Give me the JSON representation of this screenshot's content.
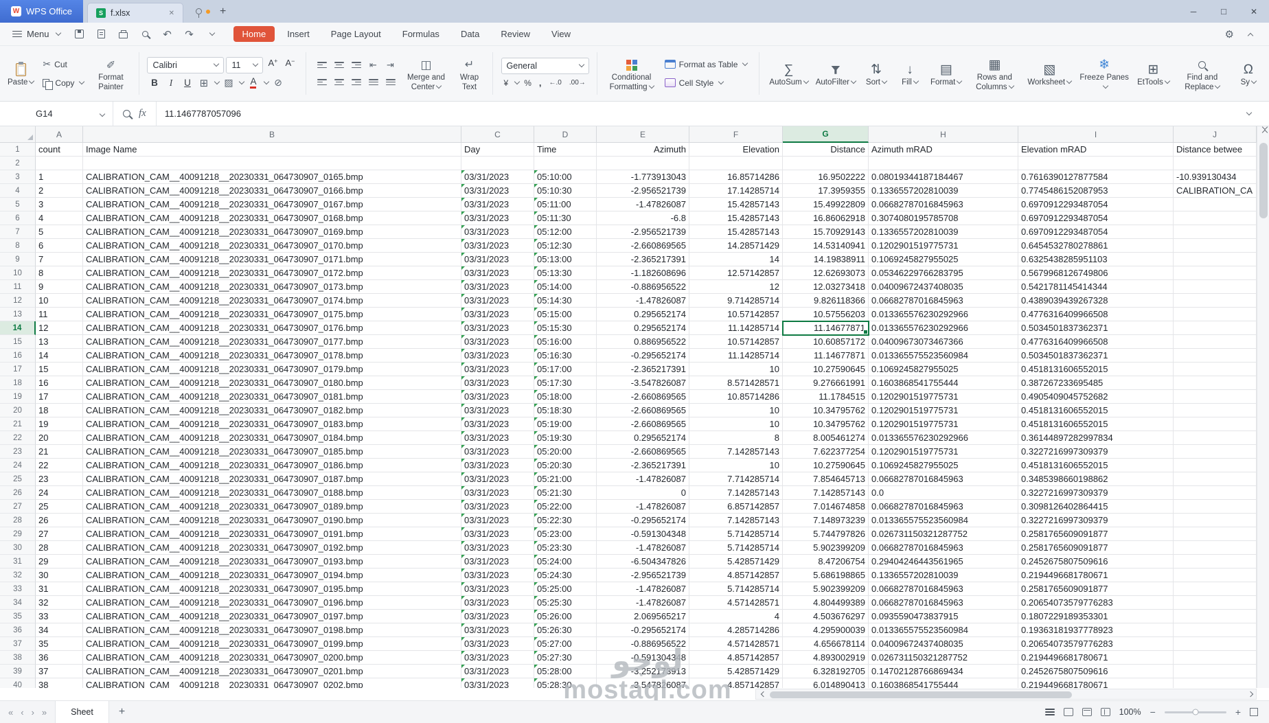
{
  "titlebar": {
    "app_tab": "WPS Office",
    "doc_tab": "f.xlsx"
  },
  "menubar": {
    "menu_label": "Menu",
    "tabs": [
      "Home",
      "Insert",
      "Page Layout",
      "Formulas",
      "Data",
      "Review",
      "View"
    ],
    "active_tab": "Home"
  },
  "ribbon": {
    "clipboard": {
      "paste": "Paste",
      "cut": "Cut",
      "copy": "Copy",
      "format_painter": "Format Painter"
    },
    "font": {
      "family": "Calibri",
      "size": "11"
    },
    "alignment": {
      "merge": "Merge and Center",
      "wrap": "Wrap Text"
    },
    "number": {
      "format": "General"
    },
    "styles": {
      "conditional": "Conditional Formatting",
      "table": "Format as Table",
      "cell": "Cell Style"
    },
    "tools": [
      "AutoSum",
      "AutoFilter",
      "Sort",
      "Fill",
      "Format",
      "Rows and Columns",
      "Worksheet",
      "Freeze Panes",
      "EtTools",
      "Find and Replace",
      "Sy"
    ]
  },
  "formula_bar": {
    "name_box": "G14",
    "fx_label": "fx",
    "value": "11.1467787057096"
  },
  "statusbar": {
    "sheet_tab": "Sheet",
    "zoom": "100%"
  },
  "watermark": {
    "line1": "لوجو",
    "line2": "mostaql.com"
  },
  "sheet": {
    "columns": [
      "A",
      "B",
      "C",
      "D",
      "E",
      "F",
      "G",
      "H",
      "I",
      "J"
    ],
    "selection": {
      "col": "G",
      "row": 14
    },
    "rows": [
      {
        "n": 1,
        "v": [
          "count",
          "Image Name",
          "Day",
          "Time",
          "Azimuth",
          "Elevation",
          "Distance",
          "Azimuth mRAD",
          "Elevation mRAD",
          "Distance betwee"
        ]
      },
      {
        "n": 2,
        "v": [
          "",
          "",
          "",
          "",
          "",
          "",
          "",
          "",
          "",
          ""
        ]
      },
      {
        "n": 3,
        "v": [
          "1",
          "CALIBRATION_CAM__40091218__20230331_064730907_0165.bmp",
          "03/31/2023",
          "05:10:00",
          "-1.773913043",
          "16.85714286",
          "16.9502222",
          "0.08019344187184467",
          "0.7616390127877584",
          "-10.939130434"
        ]
      },
      {
        "n": 4,
        "v": [
          "2",
          "CALIBRATION_CAM__40091218__20230331_064730907_0166.bmp",
          "03/31/2023",
          "05:10:30",
          "-2.956521739",
          "17.14285714",
          "17.3959355",
          "0.1336557202810039",
          "0.7745486152087953",
          "CALIBRATION_CA"
        ]
      },
      {
        "n": 5,
        "v": [
          "3",
          "CALIBRATION_CAM__40091218__20230331_064730907_0167.bmp",
          "03/31/2023",
          "05:11:00",
          "-1.47826087",
          "15.42857143",
          "15.49922809",
          "0.06682787016845963",
          "0.6970912293487054",
          ""
        ]
      },
      {
        "n": 6,
        "v": [
          "4",
          "CALIBRATION_CAM__40091218__20230331_064730907_0168.bmp",
          "03/31/2023",
          "05:11:30",
          "-6.8",
          "15.42857143",
          "16.86062918",
          "0.3074080195785708",
          "0.6970912293487054",
          ""
        ]
      },
      {
        "n": 7,
        "v": [
          "5",
          "CALIBRATION_CAM__40091218__20230331_064730907_0169.bmp",
          "03/31/2023",
          "05:12:00",
          "-2.956521739",
          "15.42857143",
          "15.70929143",
          "0.1336557202810039",
          "0.6970912293487054",
          ""
        ]
      },
      {
        "n": 8,
        "v": [
          "6",
          "CALIBRATION_CAM__40091218__20230331_064730907_0170.bmp",
          "03/31/2023",
          "05:12:30",
          "-2.660869565",
          "14.28571429",
          "14.53140941",
          "0.1202901519775731",
          "0.6454532780278861",
          ""
        ]
      },
      {
        "n": 9,
        "v": [
          "7",
          "CALIBRATION_CAM__40091218__20230331_064730907_0171.bmp",
          "03/31/2023",
          "05:13:00",
          "-2.365217391",
          "14",
          "14.19838911",
          "0.1069245827955025",
          "0.6325438285951103",
          ""
        ]
      },
      {
        "n": 10,
        "v": [
          "8",
          "CALIBRATION_CAM__40091218__20230331_064730907_0172.bmp",
          "03/31/2023",
          "05:13:30",
          "-1.182608696",
          "12.57142857",
          "12.62693073",
          "0.05346229766283795",
          "0.5679968126749806",
          ""
        ]
      },
      {
        "n": 11,
        "v": [
          "9",
          "CALIBRATION_CAM__40091218__20230331_064730907_0173.bmp",
          "03/31/2023",
          "05:14:00",
          "-0.886956522",
          "12",
          "12.03273418",
          "0.04009672437408035",
          "0.5421781145414344",
          ""
        ]
      },
      {
        "n": 12,
        "v": [
          "10",
          "CALIBRATION_CAM__40091218__20230331_064730907_0174.bmp",
          "03/31/2023",
          "05:14:30",
          "-1.47826087",
          "9.714285714",
          "9.826118366",
          "0.06682787016845963",
          "0.4389039439267328",
          ""
        ]
      },
      {
        "n": 13,
        "v": [
          "11",
          "CALIBRATION_CAM__40091218__20230331_064730907_0175.bmp",
          "03/31/2023",
          "05:15:00",
          "0.295652174",
          "10.57142857",
          "10.57556203",
          "0.013365576230292966",
          "0.4776316409966508",
          ""
        ]
      },
      {
        "n": 14,
        "v": [
          "12",
          "CALIBRATION_CAM__40091218__20230331_064730907_0176.bmp",
          "03/31/2023",
          "05:15:30",
          "0.295652174",
          "11.14285714",
          "11.14677871",
          "0.013365576230292966",
          "0.5034501837362371",
          ""
        ]
      },
      {
        "n": 15,
        "v": [
          "13",
          "CALIBRATION_CAM__40091218__20230331_064730907_0177.bmp",
          "03/31/2023",
          "05:16:00",
          "0.886956522",
          "10.57142857",
          "10.60857172",
          "0.04009673073467366",
          "0.4776316409966508",
          ""
        ]
      },
      {
        "n": 16,
        "v": [
          "14",
          "CALIBRATION_CAM__40091218__20230331_064730907_0178.bmp",
          "03/31/2023",
          "05:16:30",
          "-0.295652174",
          "11.14285714",
          "11.14677871",
          "0.013365575523560984",
          "0.5034501837362371",
          ""
        ]
      },
      {
        "n": 17,
        "v": [
          "15",
          "CALIBRATION_CAM__40091218__20230331_064730907_0179.bmp",
          "03/31/2023",
          "05:17:00",
          "-2.365217391",
          "10",
          "10.27590645",
          "0.1069245827955025",
          "0.4518131606552015",
          ""
        ]
      },
      {
        "n": 18,
        "v": [
          "16",
          "CALIBRATION_CAM__40091218__20230331_064730907_0180.bmp",
          "03/31/2023",
          "05:17:30",
          "-3.547826087",
          "8.571428571",
          "9.276661991",
          "0.1603868541755444",
          "0.387267233695485",
          ""
        ]
      },
      {
        "n": 19,
        "v": [
          "17",
          "CALIBRATION_CAM__40091218__20230331_064730907_0181.bmp",
          "03/31/2023",
          "05:18:00",
          "-2.660869565",
          "10.85714286",
          "11.1784515",
          "0.1202901519775731",
          "0.4905409045752682",
          ""
        ]
      },
      {
        "n": 20,
        "v": [
          "18",
          "CALIBRATION_CAM__40091218__20230331_064730907_0182.bmp",
          "03/31/2023",
          "05:18:30",
          "-2.660869565",
          "10",
          "10.34795762",
          "0.1202901519775731",
          "0.4518131606552015",
          ""
        ]
      },
      {
        "n": 21,
        "v": [
          "19",
          "CALIBRATION_CAM__40091218__20230331_064730907_0183.bmp",
          "03/31/2023",
          "05:19:00",
          "-2.660869565",
          "10",
          "10.34795762",
          "0.1202901519775731",
          "0.4518131606552015",
          ""
        ]
      },
      {
        "n": 22,
        "v": [
          "20",
          "CALIBRATION_CAM__40091218__20230331_064730907_0184.bmp",
          "03/31/2023",
          "05:19:30",
          "0.295652174",
          "8",
          "8.005461274",
          "0.013365576230292966",
          "0.36144897282997834",
          ""
        ]
      },
      {
        "n": 23,
        "v": [
          "21",
          "CALIBRATION_CAM__40091218__20230331_064730907_0185.bmp",
          "03/31/2023",
          "05:20:00",
          "-2.660869565",
          "7.142857143",
          "7.622377254",
          "0.1202901519775731",
          "0.3227216997309379",
          ""
        ]
      },
      {
        "n": 24,
        "v": [
          "22",
          "CALIBRATION_CAM__40091218__20230331_064730907_0186.bmp",
          "03/31/2023",
          "05:20:30",
          "-2.365217391",
          "10",
          "10.27590645",
          "0.1069245827955025",
          "0.4518131606552015",
          ""
        ]
      },
      {
        "n": 25,
        "v": [
          "23",
          "CALIBRATION_CAM__40091218__20230331_064730907_0187.bmp",
          "03/31/2023",
          "05:21:00",
          "-1.47826087",
          "7.714285714",
          "7.854645713",
          "0.06682787016845963",
          "0.3485398660198862",
          ""
        ]
      },
      {
        "n": 26,
        "v": [
          "24",
          "CALIBRATION_CAM__40091218__20230331_064730907_0188.bmp",
          "03/31/2023",
          "05:21:30",
          "0",
          "7.142857143",
          "7.142857143",
          "0.0",
          "0.3227216997309379",
          ""
        ]
      },
      {
        "n": 27,
        "v": [
          "25",
          "CALIBRATION_CAM__40091218__20230331_064730907_0189.bmp",
          "03/31/2023",
          "05:22:00",
          "-1.47826087",
          "6.857142857",
          "7.014674858",
          "0.06682787016845963",
          "0.3098126402864415",
          ""
        ]
      },
      {
        "n": 28,
        "v": [
          "26",
          "CALIBRATION_CAM__40091218__20230331_064730907_0190.bmp",
          "03/31/2023",
          "05:22:30",
          "-0.295652174",
          "7.142857143",
          "7.148973239",
          "0.013365575523560984",
          "0.3227216997309379",
          ""
        ]
      },
      {
        "n": 29,
        "v": [
          "27",
          "CALIBRATION_CAM__40091218__20230331_064730907_0191.bmp",
          "03/31/2023",
          "05:23:00",
          "-0.591304348",
          "5.714285714",
          "5.744797826",
          "0.026731150321287752",
          "0.2581765609091877",
          ""
        ]
      },
      {
        "n": 30,
        "v": [
          "28",
          "CALIBRATION_CAM__40091218__20230331_064730907_0192.bmp",
          "03/31/2023",
          "05:23:30",
          "-1.47826087",
          "5.714285714",
          "5.902399209",
          "0.06682787016845963",
          "0.2581765609091877",
          ""
        ]
      },
      {
        "n": 31,
        "v": [
          "29",
          "CALIBRATION_CAM__40091218__20230331_064730907_0193.bmp",
          "03/31/2023",
          "05:24:00",
          "-6.504347826",
          "5.428571429",
          "8.47206754",
          "0.29404246443561965",
          "0.2452675807509616",
          ""
        ]
      },
      {
        "n": 32,
        "v": [
          "30",
          "CALIBRATION_CAM__40091218__20230331_064730907_0194.bmp",
          "03/31/2023",
          "05:24:30",
          "-2.956521739",
          "4.857142857",
          "5.686198865",
          "0.1336557202810039",
          "0.2194496681780671",
          ""
        ]
      },
      {
        "n": 33,
        "v": [
          "31",
          "CALIBRATION_CAM__40091218__20230331_064730907_0195.bmp",
          "03/31/2023",
          "05:25:00",
          "-1.47826087",
          "5.714285714",
          "5.902399209",
          "0.06682787016845963",
          "0.2581765609091877",
          ""
        ]
      },
      {
        "n": 34,
        "v": [
          "32",
          "CALIBRATION_CAM__40091218__20230331_064730907_0196.bmp",
          "03/31/2023",
          "05:25:30",
          "-1.47826087",
          "4.571428571",
          "4.804499389",
          "0.06682787016845963",
          "0.20654073579776283",
          ""
        ]
      },
      {
        "n": 35,
        "v": [
          "33",
          "CALIBRATION_CAM__40091218__20230331_064730907_0197.bmp",
          "03/31/2023",
          "05:26:00",
          "2.069565217",
          "4",
          "4.503676297",
          "0.0935590473837915",
          "0.1807229189353301",
          ""
        ]
      },
      {
        "n": 36,
        "v": [
          "34",
          "CALIBRATION_CAM__40091218__20230331_064730907_0198.bmp",
          "03/31/2023",
          "05:26:30",
          "-0.295652174",
          "4.285714286",
          "4.295900039",
          "0.013365575523560984",
          "0.19363181937778923",
          ""
        ]
      },
      {
        "n": 37,
        "v": [
          "35",
          "CALIBRATION_CAM__40091218__20230331_064730907_0199.bmp",
          "03/31/2023",
          "05:27:00",
          "-0.886956522",
          "4.571428571",
          "4.656678114",
          "0.04009672437408035",
          "0.20654073579776283",
          ""
        ]
      },
      {
        "n": 38,
        "v": [
          "36",
          "CALIBRATION_CAM__40091218__20230331_064730907_0200.bmp",
          "03/31/2023",
          "05:27:30",
          "-0.591304348",
          "4.857142857",
          "4.893002919",
          "0.026731150321287752",
          "0.2194496681780671",
          ""
        ]
      },
      {
        "n": 39,
        "v": [
          "37",
          "CALIBRATION_CAM__40091218__20230331_064730907_0201.bmp",
          "03/31/2023",
          "05:28:00",
          "-3.252173913",
          "5.428571429",
          "6.328192705",
          "0.14702128766869434",
          "0.2452675807509616",
          ""
        ]
      },
      {
        "n": 40,
        "v": [
          "38",
          "CALIBRATION_CAM__40091218__20230331_064730907_0202.bmp",
          "03/31/2023",
          "05:28:30",
          "-3.547826087",
          "4.857142857",
          "6.014890413",
          "0.1603868541755444",
          "0.2194496681780671",
          ""
        ]
      }
    ]
  }
}
